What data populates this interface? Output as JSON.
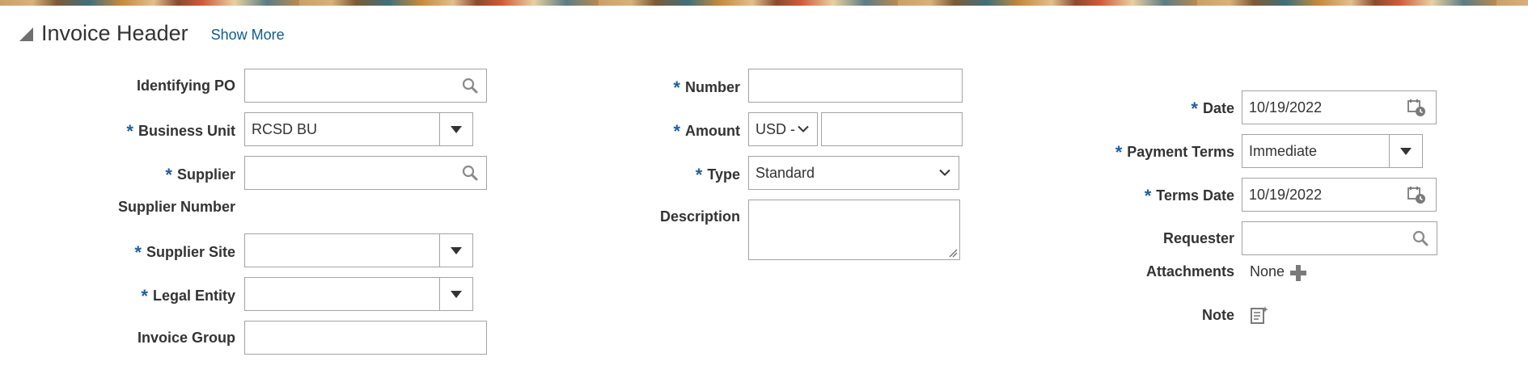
{
  "section": {
    "title": "Invoice Header",
    "show_more": "Show More"
  },
  "left": {
    "identifying_po": {
      "label": "Identifying PO",
      "value": ""
    },
    "business_unit": {
      "label": "Business Unit",
      "value": "RCSD BU"
    },
    "supplier": {
      "label": "Supplier",
      "value": ""
    },
    "supplier_number": {
      "label": "Supplier Number"
    },
    "supplier_site": {
      "label": "Supplier Site",
      "value": ""
    },
    "legal_entity": {
      "label": "Legal Entity",
      "value": ""
    },
    "invoice_group": {
      "label": "Invoice Group",
      "value": ""
    }
  },
  "middle": {
    "number": {
      "label": "Number",
      "value": ""
    },
    "amount": {
      "label": "Amount",
      "currency": "USD -",
      "value": ""
    },
    "type": {
      "label": "Type",
      "value": "Standard"
    },
    "description": {
      "label": "Description",
      "value": ""
    }
  },
  "right": {
    "date": {
      "label": "Date",
      "value": "10/19/2022"
    },
    "payment_terms": {
      "label": "Payment Terms",
      "value": "Immediate"
    },
    "terms_date": {
      "label": "Terms Date",
      "value": "10/19/2022"
    },
    "requester": {
      "label": "Requester",
      "value": ""
    },
    "attachments": {
      "label": "Attachments",
      "value": "None"
    },
    "note": {
      "label": "Note"
    }
  },
  "required_marker": "*",
  "icons": {
    "search": "search-icon",
    "dropdown": "triangle-down-icon",
    "chevron": "chevron-down-icon",
    "calendar": "calendar-icon",
    "add": "plus-icon",
    "note": "note-icon",
    "disclosure": "disclosure-triangle-icon"
  },
  "colors": {
    "accent_link": "#0f5b8f",
    "required": "#1e5fa0",
    "border": "#a3a3a3",
    "text": "#333333"
  }
}
